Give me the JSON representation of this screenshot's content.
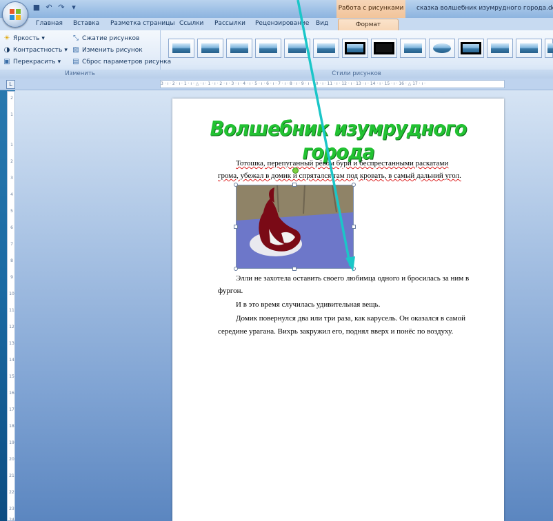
{
  "window": {
    "context_tab_group": "Работа с рисунками",
    "document_title": "сказка  волшебник изумрудного города.docx -"
  },
  "tabs": [
    {
      "label": "Главная"
    },
    {
      "label": "Вставка"
    },
    {
      "label": "Разметка страницы"
    },
    {
      "label": "Ссылки"
    },
    {
      "label": "Рассылки"
    },
    {
      "label": "Рецензирование"
    },
    {
      "label": "Вид"
    },
    {
      "label": "Формат",
      "active": true
    }
  ],
  "ribbon": {
    "adjust_group": {
      "brightness": "Яркость",
      "contrast": "Контрастность",
      "recolor": "Перекрасить",
      "compress": "Сжатие рисунков",
      "change": "Изменить рисунок",
      "reset": "Сброс параметров рисунка",
      "label": "Изменить"
    },
    "styles_group": {
      "label": "Стили рисунков",
      "thumb_count": 14
    }
  },
  "ruler": {
    "marks": "3 · ı · 2 · ı · 1 · ı · △ · ı · 1 · ı · 2 · ı · 3 · ı · 4 · ı · 5 · ı · 6 · ı · 7 · ı · 8 · ı · 9 · ı · 10 · ı · 11 · ı · 12 · ı · 13 · ı · 14 · ı · 15 · ı · 16 · △ 17 · ı ·"
  },
  "vruler": [
    "2",
    "1",
    "1",
    "2",
    "3",
    "4",
    "5",
    "6",
    "7",
    "8",
    "9",
    "10",
    "11",
    "12",
    "13",
    "14",
    "15",
    "16",
    "17",
    "18",
    "19",
    "20",
    "21",
    "22",
    "23",
    "24"
  ],
  "document": {
    "heading": "Волшебник изумрудного города",
    "para1_line1": "Тотошка, перепуганный рёвом бури и беспрестанными раскатами",
    "para1_line2": "грома, убежал в домик и спрятался там под кровать, в самый дальний угол.",
    "para2_line1": "Элли не захотела оставить своего любимца одного и бросилась за ним в",
    "para2_line2": "фургон.",
    "para3": "И в это время случилась удивительная вещь.",
    "para4_line1": "Домик повернулся два или три раза, как карусель. Он оказался в самой",
    "para4_line2": "середине урагана. Вихрь закружил его, поднял вверх и понёс по воздуху."
  },
  "colors": {
    "heading": "#22c232",
    "arrow": "#1bc6c8",
    "format_tab": "#f7d6b6"
  }
}
